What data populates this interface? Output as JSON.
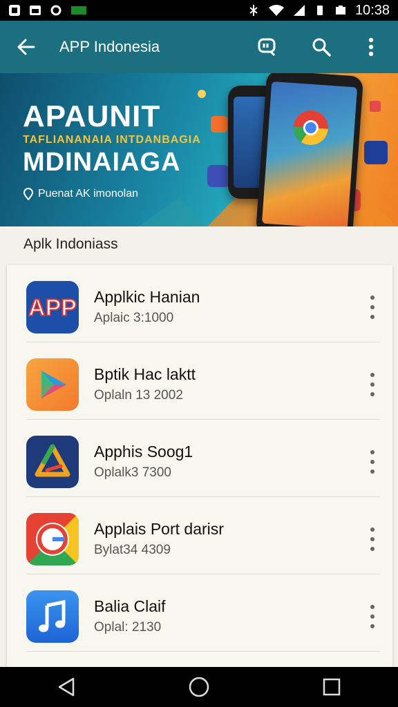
{
  "status_bar": {
    "time": "10:38"
  },
  "app_bar": {
    "title": "APP Indonesia"
  },
  "banner": {
    "headline_1": "APAUNIT",
    "subline": "TAFLIANANAIA INTDANBAGIA",
    "headline_2": "MDINAIAGA",
    "tagline": "Puenat AK imonolan"
  },
  "section": {
    "title": "Aplk Indoniass"
  },
  "apps": [
    {
      "name": "Applkic Hanian",
      "meta": "Aplaic 3:1000",
      "icon": "app-letters-icon",
      "colors": [
        "#1d4fa8",
        "#e8312e"
      ]
    },
    {
      "name": "Bptik Hac laktt",
      "meta": "Oplaln 13 2002",
      "icon": "play-triangle-icon",
      "colors": [
        "#f59a3a",
        "#e34b7b"
      ]
    },
    {
      "name": "Apphis Soog1",
      "meta": "Oplalk3 7300",
      "icon": "drive-triangle-icon",
      "colors": [
        "#1f3a7a",
        "#f2a31d"
      ]
    },
    {
      "name": "Applais Port darisr",
      "meta": "Bylat34 4309",
      "icon": "chrome-icon",
      "colors": [
        "#e54233",
        "#30a853"
      ]
    },
    {
      "name": "Balia Claif",
      "meta": "Oplal: 2130",
      "icon": "music-note-icon",
      "colors": [
        "#2b7ee6",
        "#ffffff"
      ]
    }
  ]
}
